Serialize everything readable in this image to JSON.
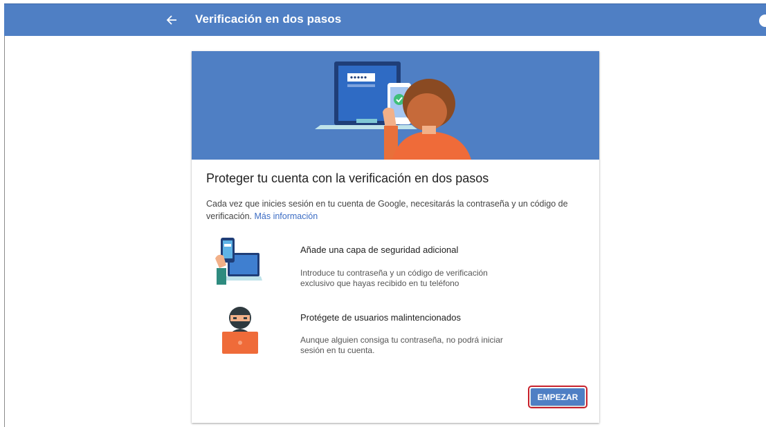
{
  "header": {
    "title": "Verificación en dos pasos",
    "back_icon": "arrow-back-icon",
    "help_icon": "help-icon"
  },
  "card": {
    "title": "Proteger tu cuenta con la verificación en dos pasos",
    "description": "Cada vez que inicies sesión en tu cuenta de Google, necesitarás la contraseña y un código de verificación.",
    "more_info_link": "Más información",
    "features": [
      {
        "icon": "phone-laptop-illustration",
        "title": "Añade una capa de seguridad adicional",
        "description": "Introduce tu contraseña y un código de verificación exclusivo que hayas recibido en tu teléfono"
      },
      {
        "icon": "hacker-illustration",
        "title": "Protégete de usuarios malintencionados",
        "description": "Aunque alguien consiga tu contraseña, no podrá iniciar sesión en tu cuenta."
      }
    ],
    "start_button": "EMPEZAR"
  },
  "colors": {
    "brand_blue": "#4f7fc4",
    "link_blue": "#3b6cc4",
    "highlight_red": "#c8202b"
  }
}
